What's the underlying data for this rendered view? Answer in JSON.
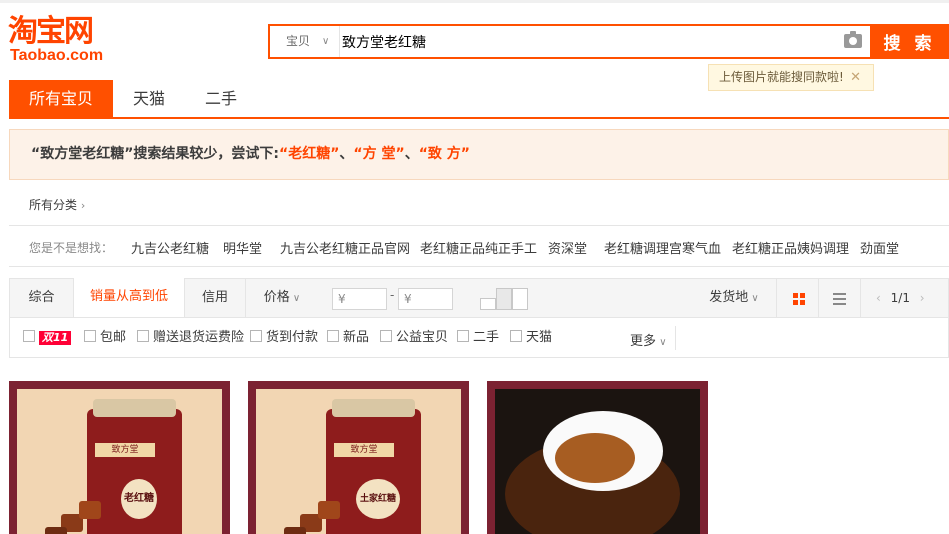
{
  "logo": {
    "cn": "淘宝网",
    "en": "Taobao.com"
  },
  "search": {
    "type_label": "宝贝",
    "query": "致方堂老红糖",
    "button_label": "搜 索",
    "tip": "上传图片就能搜同款啦!"
  },
  "tabs": [
    {
      "label": "所有宝贝",
      "active": true
    },
    {
      "label": "天猫",
      "active": false
    },
    {
      "label": "二手",
      "active": false
    }
  ],
  "notice": {
    "prefix": "“致方堂老红糖”搜索结果较少，尝试下:",
    "keywords": [
      "“老红糖”",
      "“方 堂”",
      "“致 方”"
    ],
    "separator": "、"
  },
  "all_categories": "所有分类",
  "suggestions": {
    "label": "您是不是想找：",
    "items": [
      "九吉公老红糖",
      "明华堂",
      "九吉公老红糖正品官网",
      "老红糖正品纯正手工",
      "资深堂",
      "老红糖调理宫寒气血",
      "老红糖正品姨妈调理",
      "劲面堂"
    ]
  },
  "sort": {
    "items": [
      "综合",
      "销量从高到低",
      "信用",
      "价格"
    ],
    "active": "销量从高到低",
    "price_min_placeholder": "¥",
    "price_max_placeholder": "¥",
    "price_dash": "-",
    "location": "发货地",
    "pager": "1/1"
  },
  "filters": {
    "double11": "双11",
    "items": [
      "包邮",
      "赠送退货运费险",
      "货到付款",
      "新品",
      "公益宝贝",
      "二手",
      "天猫"
    ],
    "more": "更多"
  },
  "products": [
    {
      "brand": "致方堂",
      "label": "老红糖"
    },
    {
      "brand": "致方堂",
      "label": "土家红糖"
    },
    {
      "image": "spoon-of-brown-sugar-syrup"
    }
  ],
  "colors": {
    "accent": "#ff5000",
    "highlight": "#ff4400"
  }
}
